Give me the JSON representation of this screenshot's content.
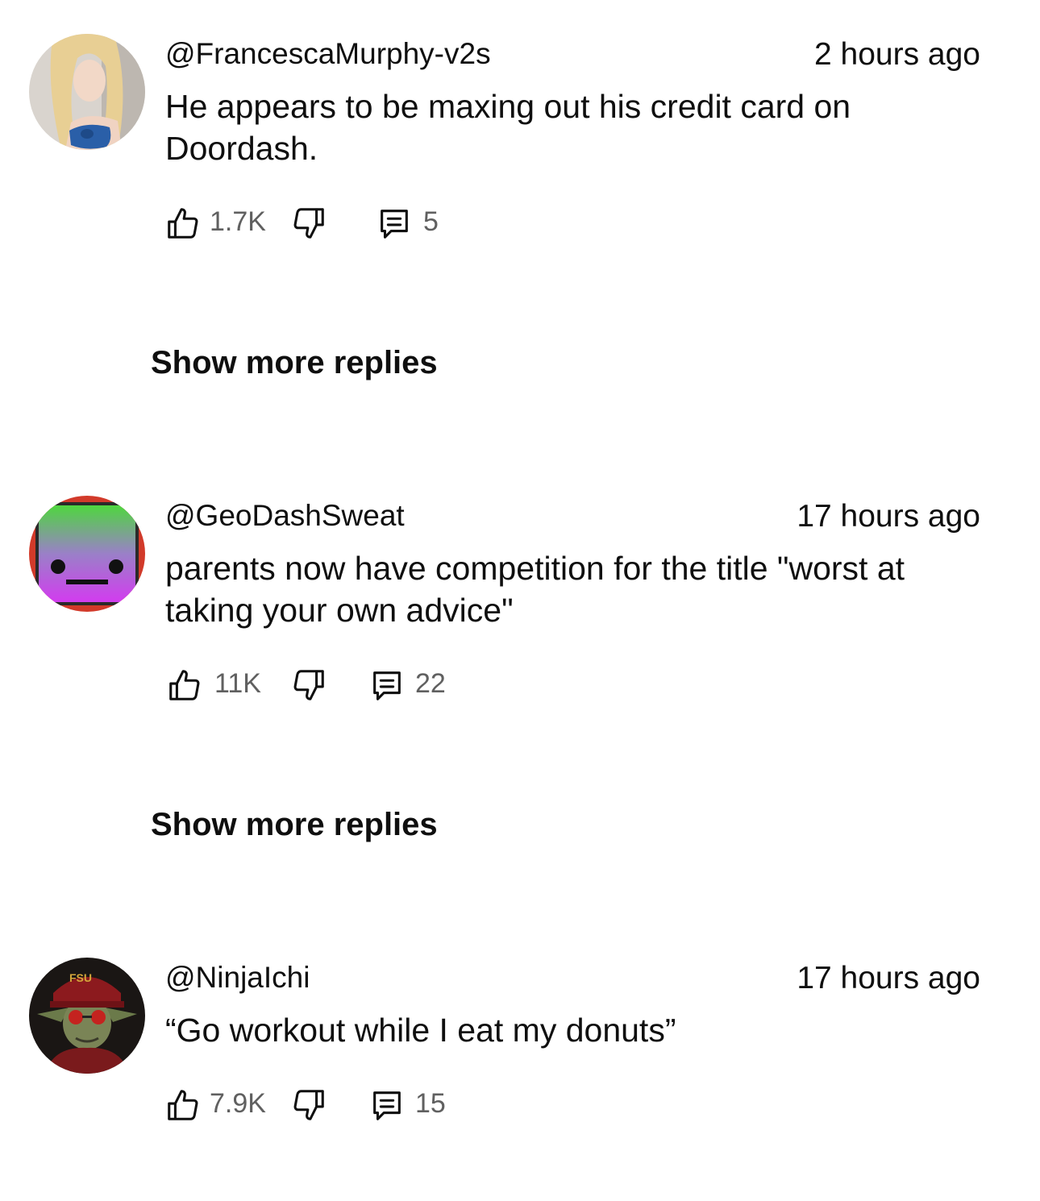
{
  "comments": [
    {
      "handle": "@FrancescaMurphy-v2s",
      "time": "2 hours ago",
      "text": "He appears to be maxing out his credit card on Doordash.",
      "likes": "1.7K",
      "replies": "5",
      "avatar": "woman-blonde-avatar"
    },
    {
      "handle": "@GeoDashSweat",
      "time": "17 hours ago",
      "text": "parents now have competition for the title \"worst at taking your own advice\"",
      "likes": "11K",
      "replies": "22",
      "avatar": "geometry-dash-cube-avatar"
    },
    {
      "handle": "@NinjaIchi",
      "time": "17 hours ago",
      "text": "“Go workout while I eat my donuts”",
      "likes": "7.9K",
      "replies": "15",
      "avatar": "goblin-fsu-cap-avatar",
      "avatar_cap_text": "FSU"
    }
  ],
  "show_more_label": "Show more replies",
  "icons": {
    "like": "thumbs-up-icon",
    "dislike": "thumbs-down-icon",
    "reply": "comment-icon",
    "more": "more-vert-icon"
  },
  "colors": {
    "text": "#0f0f0f",
    "secondary": "#606060",
    "background": "#ffffff"
  }
}
